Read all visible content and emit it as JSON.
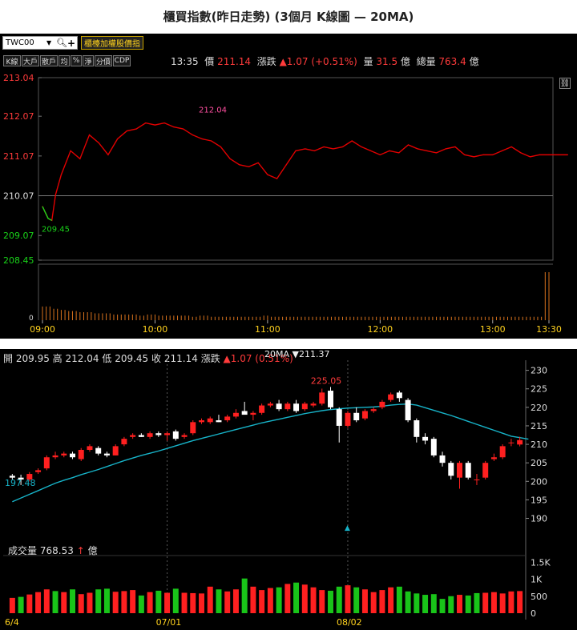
{
  "page_title": "櫃買指數(昨日走勢) (3個月 K線圖 — 20MA)",
  "intraday": {
    "symbol_select": "TWC00",
    "index_button": "櫃檯加權股價指",
    "toolbar_buttons": [
      "K線",
      "大戶",
      "散戶",
      "均",
      "%",
      "淨",
      "分價",
      "CDP"
    ],
    "quote": {
      "time": "13:35",
      "price_label": "價",
      "price": "211.14",
      "change_label": "漲跌",
      "change": "▲1.07 (+0.51%)",
      "volume_label": "量",
      "volume": "31.5",
      "volume_unit": "億",
      "total_label": "總量",
      "total": "763.4",
      "total_unit": "億"
    },
    "colors": {
      "up": "#ff3b3b",
      "down": "#19d419",
      "line": "#e00000",
      "volume": "#d8721d"
    }
  },
  "daily": {
    "header": {
      "open_label": "開",
      "open": "209.95",
      "high_label": "高",
      "high": "212.04",
      "low_label": "低",
      "low": "209.45",
      "close_label": "收",
      "close": "211.14",
      "change_label": "漲跌",
      "change": "▲1.07 (0.51%)",
      "ma_label": "20MA",
      "ma_value": "▼211.37"
    },
    "volume_label": "成交量",
    "volume_value": "768.53",
    "volume_arrow": "↑",
    "volume_unit": "億"
  },
  "chart_data": [
    {
      "type": "line",
      "title": "",
      "x_ticks": [
        "09:00",
        "10:00",
        "11:00",
        "12:00",
        "13:00",
        "13:30"
      ],
      "y_ticks": [
        "213.04",
        "212.07",
        "211.07",
        "210.07",
        "209.07",
        "208.45"
      ],
      "ylim": [
        208.45,
        213.04
      ],
      "reference_close": 210.07,
      "annotations": [
        {
          "text": "212.04",
          "x": "10:20",
          "y": 212.04
        },
        {
          "text": "209.45",
          "x": "09:05",
          "y": 209.45
        }
      ],
      "x": [
        0,
        3,
        5,
        7,
        10,
        15,
        20,
        25,
        30,
        35,
        40,
        45,
        50,
        55,
        60,
        65,
        70,
        75,
        80,
        85,
        90,
        95,
        100,
        105,
        110,
        115,
        120,
        125,
        130,
        135,
        140,
        145,
        150,
        155,
        160,
        165,
        170,
        175,
        180,
        185,
        190,
        195,
        200,
        205,
        210,
        215,
        220,
        225,
        230,
        235,
        240,
        245,
        250,
        255,
        260,
        265,
        270,
        275,
        280
      ],
      "values": [
        209.8,
        209.5,
        209.45,
        210.1,
        210.6,
        211.2,
        211.0,
        211.6,
        211.4,
        211.1,
        211.5,
        211.7,
        211.75,
        211.9,
        211.85,
        211.9,
        211.8,
        211.75,
        211.6,
        211.5,
        211.45,
        211.3,
        211.0,
        210.85,
        210.8,
        210.9,
        210.6,
        210.5,
        210.85,
        211.2,
        211.25,
        211.2,
        211.3,
        211.25,
        211.3,
        211.45,
        211.3,
        211.2,
        211.1,
        211.2,
        211.15,
        211.35,
        211.25,
        211.2,
        211.15,
        211.25,
        211.3,
        211.1,
        211.05,
        211.1,
        211.1,
        211.2,
        211.3,
        211.15,
        211.05,
        211.1,
        211.1,
        211.1,
        211.1
      ],
      "volume": {
        "ylabel": "0",
        "values": [
          12,
          10,
          9,
          8,
          7,
          7,
          6,
          6,
          5,
          5,
          5,
          4,
          5,
          4,
          4,
          4,
          4,
          3,
          4,
          3,
          3,
          3,
          3,
          3,
          3,
          4,
          3,
          3,
          3,
          3,
          3,
          3,
          3,
          3,
          3,
          3,
          3,
          3,
          3,
          3,
          3,
          3,
          3,
          3,
          3,
          3,
          3,
          3,
          3,
          3,
          3,
          3,
          3,
          3,
          3,
          3,
          3,
          3,
          42
        ]
      }
    },
    {
      "type": "candlestick",
      "title": "",
      "x_ticks": [
        "6/4",
        "07/01",
        "08/02"
      ],
      "y_ticks": [
        230,
        225,
        220,
        215,
        210,
        205,
        200,
        195,
        190
      ],
      "ylim": [
        186,
        231
      ],
      "annotations": [
        {
          "text": "225.05",
          "value": 225.05
        },
        {
          "text": "197.48",
          "value": 197.48
        }
      ],
      "ma_name": "20MA",
      "candles": [
        {
          "o": 201.5,
          "h": 202.0,
          "l": 200.5,
          "c": 201.0
        },
        {
          "o": 201.0,
          "h": 201.8,
          "l": 199.0,
          "c": 200.5
        },
        {
          "o": 200.5,
          "h": 202.5,
          "l": 200.0,
          "c": 202.0
        },
        {
          "o": 202.5,
          "h": 203.5,
          "l": 202.0,
          "c": 203.0
        },
        {
          "o": 203.5,
          "h": 207.0,
          "l": 203.0,
          "c": 206.5
        },
        {
          "o": 206.5,
          "h": 208.0,
          "l": 206.0,
          "c": 207.0
        },
        {
          "o": 207.0,
          "h": 208.0,
          "l": 206.5,
          "c": 207.5
        },
        {
          "o": 207.5,
          "h": 208.0,
          "l": 206.0,
          "c": 206.5
        },
        {
          "o": 206.0,
          "h": 209.0,
          "l": 205.5,
          "c": 208.5
        },
        {
          "o": 208.5,
          "h": 210.0,
          "l": 208.0,
          "c": 209.5
        },
        {
          "o": 209.0,
          "h": 209.5,
          "l": 207.0,
          "c": 207.5
        },
        {
          "o": 207.5,
          "h": 208.0,
          "l": 206.5,
          "c": 207.0
        },
        {
          "o": 207.0,
          "h": 210.0,
          "l": 207.0,
          "c": 209.5
        },
        {
          "o": 210.0,
          "h": 212.0,
          "l": 209.5,
          "c": 211.5
        },
        {
          "o": 212.0,
          "h": 213.0,
          "l": 211.5,
          "c": 212.5
        },
        {
          "o": 212.5,
          "h": 213.0,
          "l": 212.0,
          "c": 212.0
        },
        {
          "o": 212.0,
          "h": 213.5,
          "l": 211.5,
          "c": 213.0
        },
        {
          "o": 213.0,
          "h": 213.5,
          "l": 212.0,
          "c": 212.5
        },
        {
          "o": 212.5,
          "h": 213.5,
          "l": 211.0,
          "c": 213.0
        },
        {
          "o": 213.5,
          "h": 214.0,
          "l": 211.0,
          "c": 211.5
        },
        {
          "o": 212.0,
          "h": 213.0,
          "l": 211.5,
          "c": 212.5
        },
        {
          "o": 213.0,
          "h": 216.5,
          "l": 212.5,
          "c": 216.0
        },
        {
          "o": 216.0,
          "h": 217.0,
          "l": 215.5,
          "c": 216.5
        },
        {
          "o": 216.0,
          "h": 217.5,
          "l": 215.5,
          "c": 217.0
        },
        {
          "o": 216.5,
          "h": 218.0,
          "l": 216.0,
          "c": 216.0
        },
        {
          "o": 216.5,
          "h": 218.0,
          "l": 216.0,
          "c": 217.5
        },
        {
          "o": 217.5,
          "h": 219.5,
          "l": 217.0,
          "c": 218.5
        },
        {
          "o": 219.0,
          "h": 221.5,
          "l": 218.5,
          "c": 218.0
        },
        {
          "o": 218.0,
          "h": 219.0,
          "l": 216.5,
          "c": 218.5
        },
        {
          "o": 218.5,
          "h": 221.0,
          "l": 218.0,
          "c": 220.5
        },
        {
          "o": 220.5,
          "h": 221.5,
          "l": 220.0,
          "c": 221.0
        },
        {
          "o": 221.0,
          "h": 222.0,
          "l": 219.0,
          "c": 219.5
        },
        {
          "o": 219.5,
          "h": 221.5,
          "l": 219.0,
          "c": 221.0
        },
        {
          "o": 221.0,
          "h": 222.0,
          "l": 218.5,
          "c": 219.0
        },
        {
          "o": 219.5,
          "h": 221.5,
          "l": 219.0,
          "c": 221.0
        },
        {
          "o": 220.5,
          "h": 221.5,
          "l": 220.0,
          "c": 221.0
        },
        {
          "o": 221.0,
          "h": 225.05,
          "l": 220.5,
          "c": 224.0
        },
        {
          "o": 224.5,
          "h": 225.5,
          "l": 219.5,
          "c": 220.0
        },
        {
          "o": 219.5,
          "h": 220.0,
          "l": 210.5,
          "c": 215.0
        },
        {
          "o": 215.0,
          "h": 219.0,
          "l": 214.5,
          "c": 218.5
        },
        {
          "o": 218.5,
          "h": 220.0,
          "l": 216.0,
          "c": 216.5
        },
        {
          "o": 217.0,
          "h": 219.5,
          "l": 216.5,
          "c": 219.0
        },
        {
          "o": 219.0,
          "h": 220.0,
          "l": 218.5,
          "c": 219.5
        },
        {
          "o": 220.0,
          "h": 222.0,
          "l": 219.5,
          "c": 221.5
        },
        {
          "o": 222.0,
          "h": 224.0,
          "l": 221.5,
          "c": 223.5
        },
        {
          "o": 224.0,
          "h": 224.5,
          "l": 221.5,
          "c": 222.5
        },
        {
          "o": 222.0,
          "h": 222.5,
          "l": 216.0,
          "c": 216.5
        },
        {
          "o": 216.5,
          "h": 217.0,
          "l": 210.5,
          "c": 212.0
        },
        {
          "o": 212.0,
          "h": 213.0,
          "l": 210.0,
          "c": 211.0
        },
        {
          "o": 211.5,
          "h": 212.0,
          "l": 206.5,
          "c": 207.0
        },
        {
          "o": 207.0,
          "h": 208.0,
          "l": 204.0,
          "c": 205.0
        },
        {
          "o": 205.0,
          "h": 205.5,
          "l": 200.5,
          "c": 201.5
        },
        {
          "o": 201.0,
          "h": 205.5,
          "l": 198.0,
          "c": 205.0
        },
        {
          "o": 205.0,
          "h": 205.5,
          "l": 200.5,
          "c": 201.0
        },
        {
          "o": 200.5,
          "h": 202.0,
          "l": 199.0,
          "c": 200.5
        },
        {
          "o": 201.0,
          "h": 205.5,
          "l": 200.5,
          "c": 205.0
        },
        {
          "o": 206.0,
          "h": 207.5,
          "l": 205.5,
          "c": 206.5
        },
        {
          "o": 206.5,
          "h": 210.0,
          "l": 206.0,
          "c": 209.5
        },
        {
          "o": 210.5,
          "h": 211.5,
          "l": 209.5,
          "c": 210.5
        },
        {
          "o": 209.95,
          "h": 212.04,
          "l": 209.45,
          "c": 211.14
        }
      ],
      "ma": [
        194.5,
        195.5,
        196.5,
        197.48,
        198.5,
        199.5,
        200.3,
        201.0,
        201.8,
        202.5,
        203.2,
        204.0,
        204.8,
        205.6,
        206.3,
        207.0,
        207.6,
        208.2,
        208.9,
        209.6,
        210.3,
        211.0,
        211.6,
        212.2,
        212.8,
        213.4,
        214.0,
        214.6,
        215.2,
        215.8,
        216.3,
        216.8,
        217.3,
        217.8,
        218.3,
        218.7,
        219.1,
        219.4,
        219.6,
        219.8,
        219.9,
        220.0,
        220.1,
        220.3,
        220.6,
        220.8,
        220.9,
        220.6,
        219.9,
        219.2,
        218.5,
        217.8,
        217.0,
        216.2,
        215.4,
        214.6,
        213.8,
        213.0,
        212.2,
        211.8,
        211.4
      ],
      "volume": {
        "y_ticks": [
          "1.5K",
          "1K",
          "500",
          "0"
        ],
        "ylim": [
          0,
          1600
        ],
        "values": [
          450,
          480,
          550,
          620,
          700,
          650,
          620,
          700,
          560,
          600,
          700,
          720,
          630,
          650,
          680,
          520,
          620,
          660,
          600,
          720,
          600,
          590,
          580,
          780,
          700,
          640,
          700,
          1020,
          780,
          680,
          740,
          760,
          860,
          900,
          840,
          760,
          680,
          660,
          780,
          820,
          760,
          700,
          620,
          680,
          760,
          780,
          640,
          580,
          540,
          560,
          420,
          500,
          540,
          520,
          590,
          600,
          620,
          580,
          640,
          650
        ],
        "up": [
          true,
          false,
          true,
          true,
          true,
          false,
          true,
          false,
          true,
          true,
          false,
          false,
          true,
          true,
          true,
          false,
          true,
          false,
          true,
          false,
          true,
          true,
          true,
          true,
          false,
          true,
          true,
          false,
          true,
          true,
          true,
          false,
          true,
          false,
          true,
          true,
          true,
          false,
          false,
          true,
          false,
          true,
          true,
          true,
          true,
          false,
          false,
          false,
          false,
          false,
          false,
          false,
          true,
          false,
          false,
          true,
          true,
          true,
          true,
          true
        ]
      }
    }
  ]
}
